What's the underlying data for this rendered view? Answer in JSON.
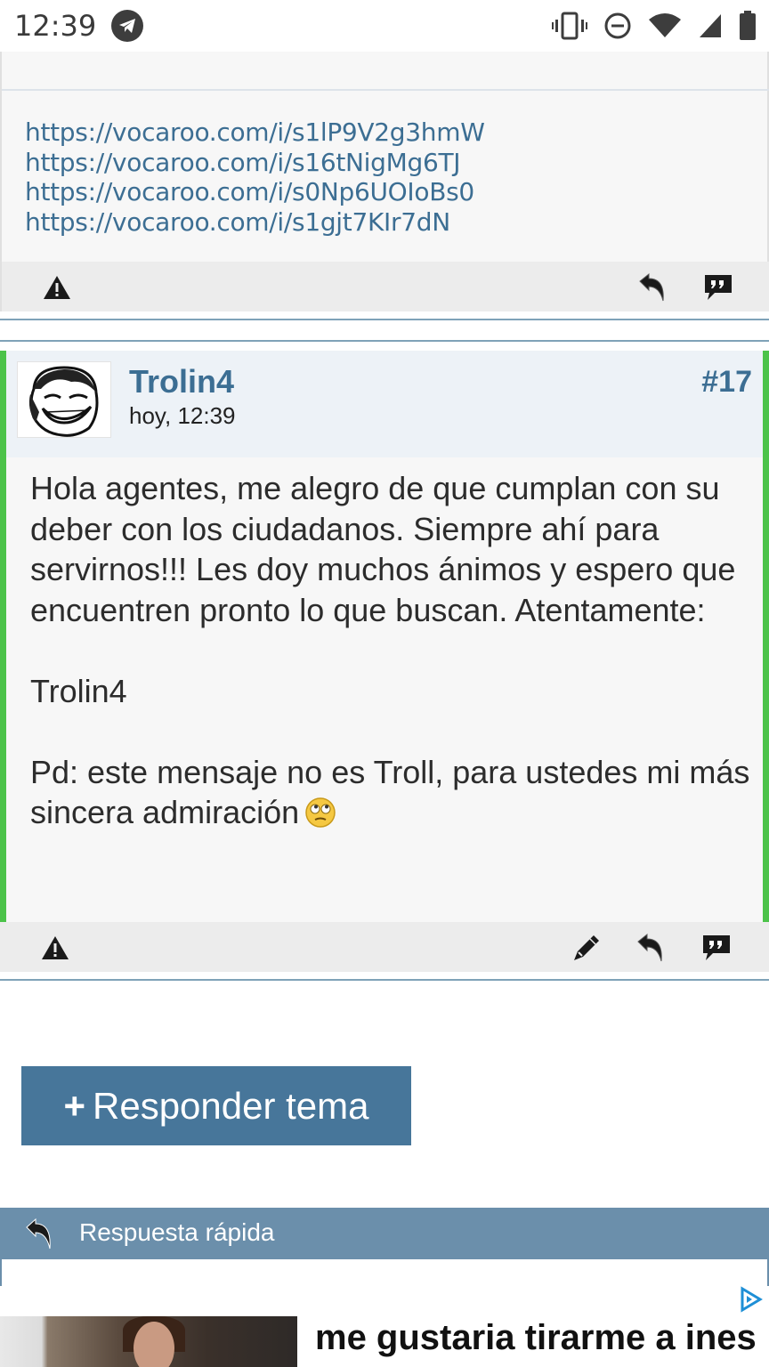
{
  "status_bar": {
    "time": "12:39",
    "icons": [
      "telegram-icon",
      "vibrate-icon",
      "do-not-disturb-icon",
      "wifi-icon",
      "signal-icon",
      "battery-icon"
    ]
  },
  "previous_post": {
    "links": [
      "https://vocaroo.com/i/s1lP9V2g3hmW",
      "https://vocaroo.com/i/s16tNigMg6TJ",
      "https://vocaroo.com/i/s0Np6UOIoBs0",
      "https://vocaroo.com/i/s1gjt7KIr7dN"
    ],
    "actions": [
      "report-icon",
      "reply-icon",
      "quote-icon"
    ]
  },
  "post": {
    "author": "Trolin4",
    "date": "hoy, 12:39",
    "number": "#17",
    "paragraphs": [
      "Hola agentes, me alegro de que cumplan con su deber con los ciudadanos. Siempre ahí para servirnos!!! Les doy muchos ánimos y espero que encuentren pronto lo que buscan. Atentamente:",
      "Trolin4",
      "Pd: este mensaje no es Troll, para ustedes mi más sincera admiración"
    ],
    "actions": [
      "report-icon",
      "edit-icon",
      "reply-icon",
      "quote-icon"
    ]
  },
  "reply_button": {
    "plus": "+",
    "label": "Responder tema"
  },
  "quick_reply": {
    "label": "Respuesta rápida"
  },
  "ad": {
    "title": "me gustaria tirarme a ines"
  },
  "colors": {
    "link": "#3c6e93",
    "accent_border": "#4cc34a",
    "button": "#47769a",
    "quick_reply_bar": "#6b8fab"
  }
}
